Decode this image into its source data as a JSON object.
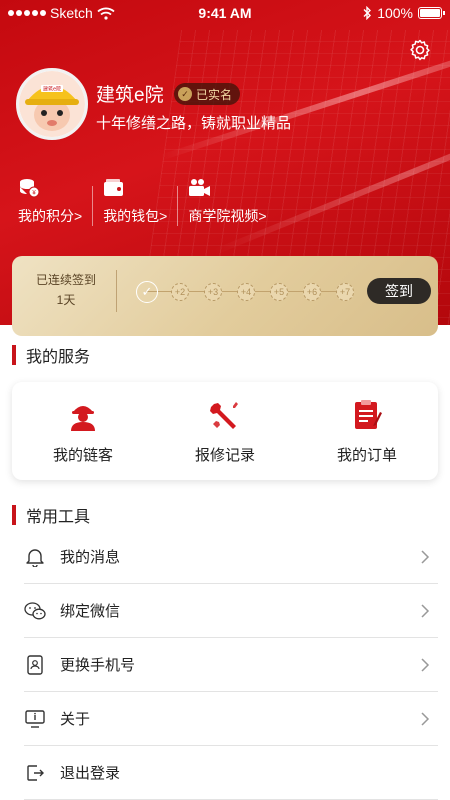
{
  "statusbar": {
    "carrier": "Sketch",
    "time": "9:41 AM",
    "battery": "100%"
  },
  "profile": {
    "name": "建筑e院",
    "verified": "已实名",
    "slogan": "十年修缮之路，铸就职业精品",
    "helmet_text": "建筑e院"
  },
  "quick_links": [
    {
      "label": "我的积分>",
      "icon": "coins-icon"
    },
    {
      "label": "我的钱包>",
      "icon": "wallet-icon"
    },
    {
      "label": "商学院视频>",
      "icon": "video-camera-icon"
    }
  ],
  "signin": {
    "streak_label": "已连续签到",
    "streak_days": "1天",
    "steps": [
      "+2",
      "+3",
      "+4",
      "+5",
      "+6",
      "+7"
    ],
    "button": "签到"
  },
  "services": {
    "title": "我的服务",
    "items": [
      {
        "label": "我的链客",
        "icon": "worker-icon"
      },
      {
        "label": "报修记录",
        "icon": "tools-icon"
      },
      {
        "label": "我的订单",
        "icon": "order-icon"
      }
    ]
  },
  "tools": {
    "title": "常用工具",
    "items": [
      {
        "label": "我的消息",
        "icon": "bell-icon"
      },
      {
        "label": "绑定微信",
        "icon": "wechat-icon"
      },
      {
        "label": "更换手机号",
        "icon": "phone-icon"
      },
      {
        "label": "关于",
        "icon": "info-icon"
      },
      {
        "label": "退出登录",
        "icon": "logout-icon"
      }
    ]
  },
  "colors": {
    "brand_red": "#c8141a",
    "gold": "#e2cc9c",
    "dark": "#2e2a26"
  }
}
